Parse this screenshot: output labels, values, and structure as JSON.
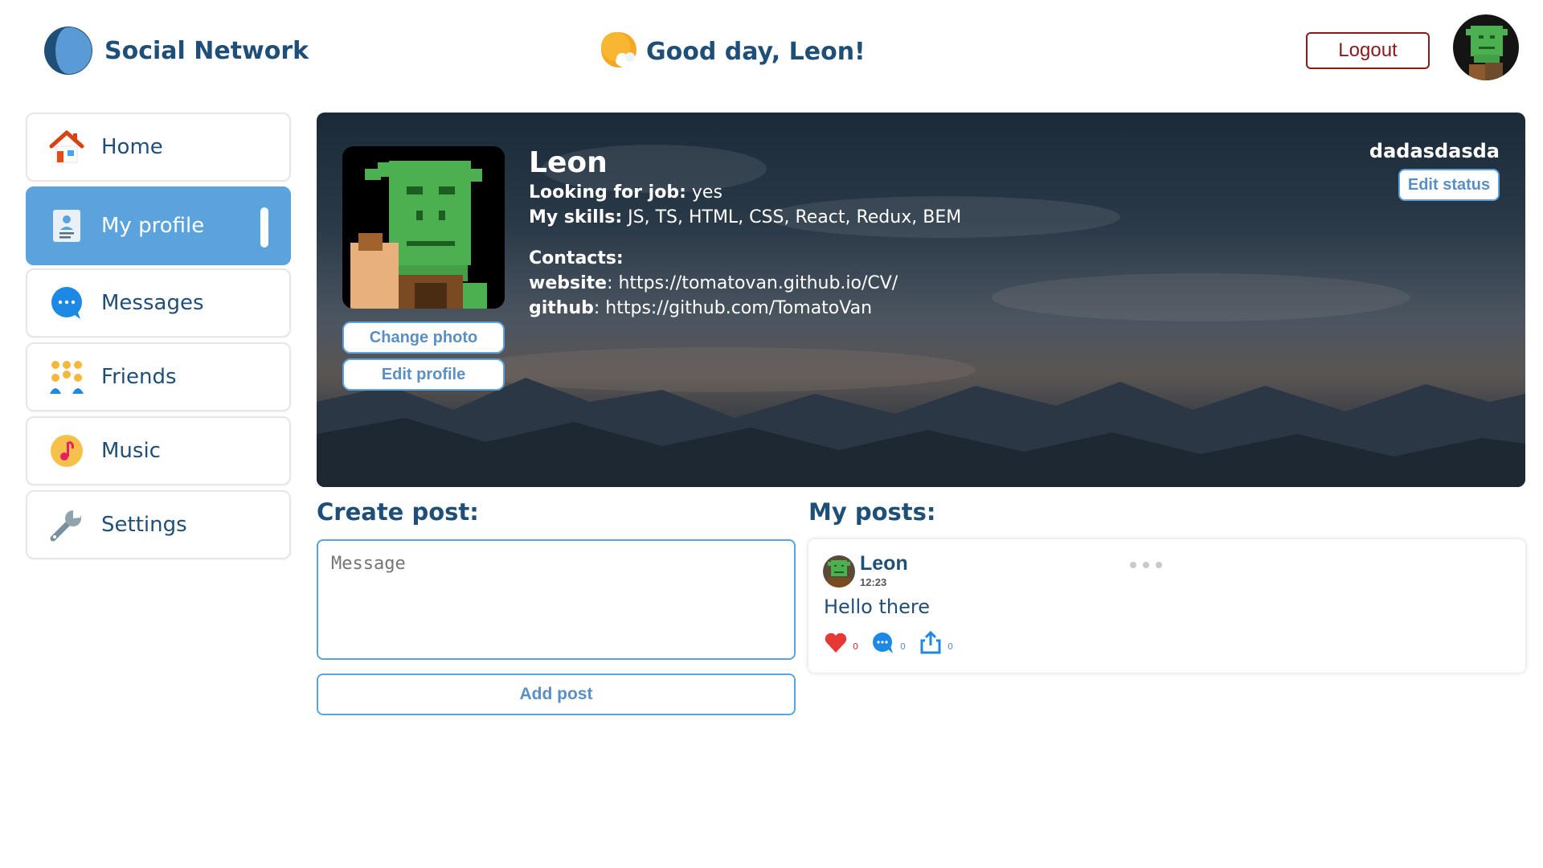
{
  "header": {
    "app_title": "Social Network",
    "greeting": "Good day, Leon!",
    "logout_label": "Logout"
  },
  "sidebar": {
    "items": [
      {
        "label": "Home",
        "icon": "home-icon",
        "active": false
      },
      {
        "label": "My profile",
        "icon": "profile-icon",
        "active": true
      },
      {
        "label": "Messages",
        "icon": "messages-icon",
        "active": false
      },
      {
        "label": "Friends",
        "icon": "friends-icon",
        "active": false
      },
      {
        "label": "Music",
        "icon": "music-icon",
        "active": false
      },
      {
        "label": "Settings",
        "icon": "wrench-icon",
        "active": false
      }
    ]
  },
  "profile": {
    "name": "Leon",
    "looking_for_job_label": "Looking for job:",
    "looking_for_job_value": "yes",
    "skills_label": "My skills:",
    "skills_value": "JS, TS, HTML, CSS, React, Redux, BEM",
    "contacts_label": "Contacts:",
    "website_label": "website",
    "website_value": "https://tomatovan.github.io/CV/",
    "github_label": "github",
    "github_value": "https://github.com/TomatoVan",
    "change_photo_label": "Change photo",
    "edit_profile_label": "Edit profile",
    "status": "dadasdasda",
    "edit_status_label": "Edit status"
  },
  "create_post": {
    "title": "Create post:",
    "placeholder": "Message",
    "value": "",
    "add_post_label": "Add post"
  },
  "posts": {
    "title": "My posts:",
    "items": [
      {
        "author": "Leon",
        "time": "12:23",
        "text": "Hello there",
        "likes": "0",
        "comments": "0",
        "shares": "0"
      }
    ]
  },
  "colors": {
    "primary": "#1f4e79",
    "accent": "#5ba3dc",
    "logout": "#8b1a1a",
    "like": "#d32f2f"
  }
}
